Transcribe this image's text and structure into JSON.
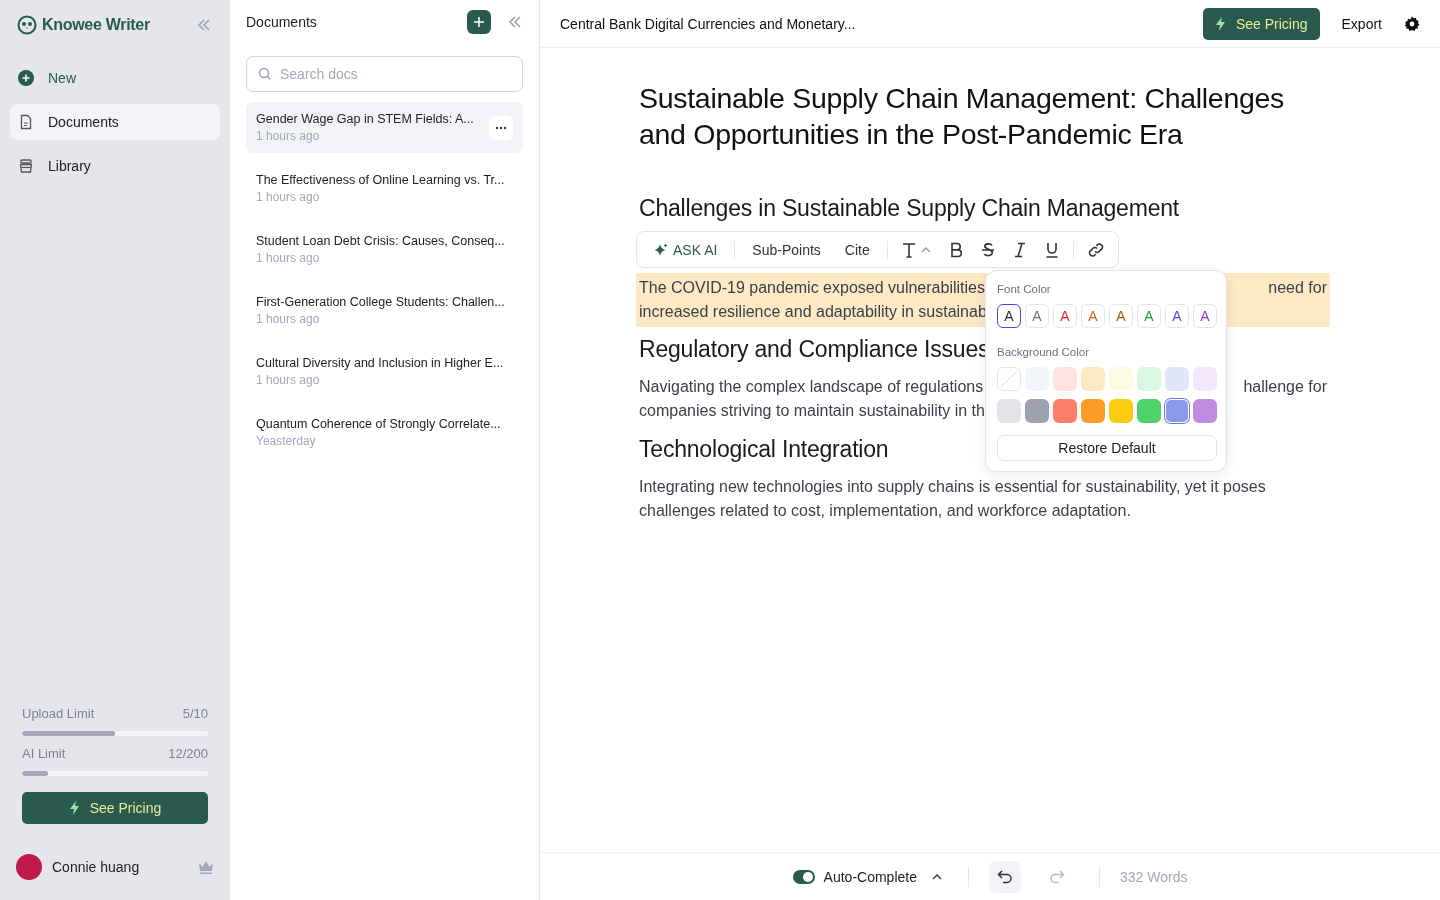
{
  "sidebar": {
    "brand": "Knowee Writer",
    "items": [
      {
        "kind": "new",
        "label": "New",
        "selected": false
      },
      {
        "kind": "doc",
        "label": "Documents",
        "selected": true
      },
      {
        "kind": "library",
        "label": "Library",
        "selected": false
      }
    ],
    "limits": [
      {
        "label": "Upload Limit",
        "value": "5/10",
        "level": 0.5
      },
      {
        "label": "AI Limit",
        "value": "12/200",
        "level": 0.14
      }
    ],
    "pricing_button": "See Pricing",
    "user": {
      "name": "Connie huang"
    }
  },
  "doc_list": {
    "title": "Documents",
    "search": {
      "placeholder": "Search docs"
    },
    "docs": [
      {
        "title": "Gender Wage Gap in STEM Fields: A...",
        "time": "1 hours ago",
        "selected": true
      },
      {
        "title": "The Effectiveness of Online Learning vs. Tr...",
        "time": "1 hours ago",
        "selected": false
      },
      {
        "title": "Student Loan Debt Crisis: Causes, Conseq...",
        "time": "1 hours ago",
        "selected": false
      },
      {
        "title": "First-Generation College Students: Challen...",
        "time": "1 hours ago",
        "selected": false
      },
      {
        "title": "Cultural Diversity and Inclusion in Higher E...",
        "time": "1 hours ago",
        "selected": false
      },
      {
        "title": "Quantum Coherence of Strongly Correlate...",
        "time": "Yeasterday",
        "selected": false
      }
    ]
  },
  "topbar": {
    "doc_title": "Central Bank Digital Currencies and Monetary...",
    "pricing_button": "See Pricing",
    "export": "Export"
  },
  "editor": {
    "blocks": [
      {
        "kind": "title",
        "text": "Sustainable Supply Chain Management: Challenges and Opportunities in the Post-Pandemic Era"
      },
      {
        "kind": "heading",
        "text": "Challenges in Sustainable Supply Chain Management"
      },
      {
        "kind": "toolbar"
      },
      {
        "kind": "paragraph",
        "highlighted": true,
        "lines": [
          [
            "The COVID-19 pandemic exposed vulnerabilities",
            "need for"
          ],
          [
            "increased resilience and adaptability in sustainab"
          ]
        ]
      },
      {
        "kind": "heading",
        "text": "Regulatory and Compliance Issues"
      },
      {
        "kind": "paragraph",
        "lines": [
          [
            "Navigating the complex landscape of regulations",
            "hallenge for"
          ],
          [
            "companies striving to maintain sustainability in th"
          ]
        ]
      },
      {
        "kind": "heading",
        "text": "Technological Integration"
      },
      {
        "kind": "paragraph",
        "lines": [
          [
            "Integrating new technologies into supply chains is essential for sustainability, yet it poses"
          ],
          [
            "challenges related to cost, implementation, and workforce adaptation."
          ]
        ]
      }
    ],
    "toolbar": {
      "ask_ai": "ASK AI",
      "buttons": [
        "Sub-Points",
        "Cite"
      ]
    },
    "color_menu": {
      "font_label": "Font Color",
      "font_colors": [
        {
          "label": "A",
          "color": "#1f2937",
          "selected": true
        },
        {
          "label": "A",
          "color": "#6b7280",
          "selected": false
        },
        {
          "label": "A",
          "color": "#dc2626",
          "selected": false
        },
        {
          "label": "A",
          "color": "#ea580c",
          "selected": false
        },
        {
          "label": "A",
          "color": "#a16207",
          "selected": false
        },
        {
          "label": "A",
          "color": "#16a34a",
          "selected": false
        },
        {
          "label": "A",
          "color": "#4f46e5",
          "selected": false
        },
        {
          "label": "A",
          "color": "#9333ea",
          "selected": false
        }
      ],
      "background_label": "Background Color",
      "backgrounds": [
        {
          "kind": "none",
          "selected": false
        },
        {
          "color": "#f1f5f9",
          "selected": false
        },
        {
          "color": "#fde2df",
          "selected": false
        },
        {
          "color": "#fde8c4",
          "selected": false
        },
        {
          "color": "#fdf9e3",
          "selected": false
        },
        {
          "color": "#dcf7e1",
          "selected": false
        },
        {
          "color": "#e0e7fb",
          "selected": false
        },
        {
          "color": "#f3e8fb",
          "selected": false
        },
        {
          "color": "#e2e4e9",
          "selected": false
        },
        {
          "color": "#9ca3af",
          "selected": false
        },
        {
          "color": "#fb7f6a",
          "selected": false
        },
        {
          "color": "#fb9c26",
          "selected": false
        },
        {
          "color": "#fccb0f",
          "selected": false
        },
        {
          "color": "#4fd26a",
          "selected": false
        },
        {
          "color": "#8b9ae8",
          "selected": true
        },
        {
          "color": "#c08ce0",
          "selected": false
        }
      ],
      "restore": "Restore Default"
    }
  },
  "footer": {
    "autocomplete": {
      "label": "Auto-Complete",
      "on": true
    },
    "undo_disabled": false,
    "redo_disabled": true,
    "words": "332 Words"
  }
}
